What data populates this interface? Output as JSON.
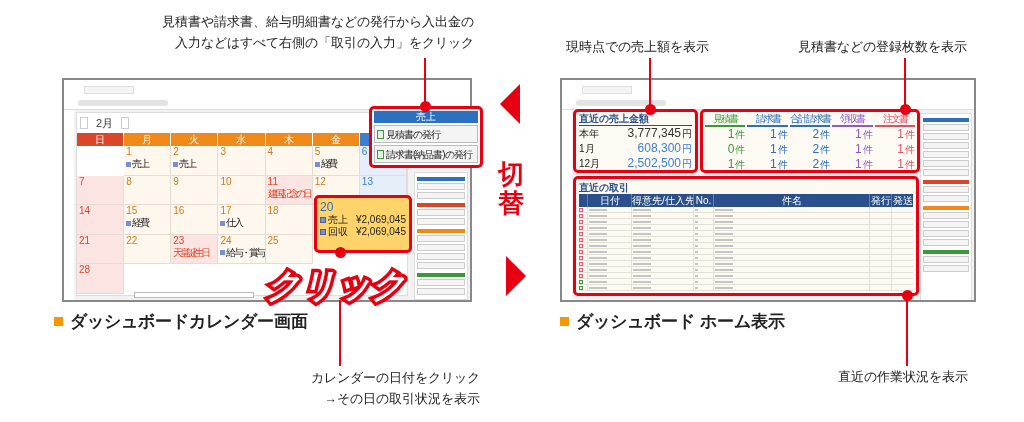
{
  "left_note": [
    "見積書や請求書、給与明細書などの発行から入出金の",
    "入力などはすべて右側の「取引の入力」をクリック"
  ],
  "price_note": "現時点での売上額を表示",
  "count_note": "見積書などの登録枚数を表示",
  "switch_label": "切替",
  "calendar_screen": {
    "month": "2月",
    "weekdays": [
      {
        "label": "日",
        "kind": "sun"
      },
      {
        "label": "月",
        "kind": "weekday"
      },
      {
        "label": "火",
        "kind": "weekday"
      },
      {
        "label": "水",
        "kind": "weekday"
      },
      {
        "label": "木",
        "kind": "weekday"
      },
      {
        "label": "金",
        "kind": "weekday"
      }
    ],
    "weeks": [
      [
        {
          "day": "1",
          "entries": [
            "売上"
          ]
        },
        {
          "day": "2",
          "entries": [
            "売上"
          ]
        },
        {
          "day": "3"
        },
        {
          "day": "4"
        },
        {
          "day": "5",
          "entries": [
            "経費"
          ]
        },
        {
          "day": "6"
        }
      ],
      [
        {
          "day": "7"
        },
        {
          "day": "8"
        },
        {
          "day": "9"
        },
        {
          "day": "10"
        },
        {
          "day": "11",
          "holiday": "建国記念の日"
        },
        {
          "day": "12"
        },
        {
          "day": "13"
        }
      ],
      [
        {
          "day": "14"
        },
        {
          "day": "15",
          "entries": [
            "経費"
          ]
        },
        {
          "day": "16"
        },
        {
          "day": "17",
          "entries": [
            "仕入"
          ]
        },
        {
          "day": "18"
        }
      ],
      [
        {
          "day": "21"
        },
        {
          "day": "22"
        },
        {
          "day": "23",
          "holiday": "天皇誕生日"
        },
        {
          "day": "24",
          "entries": [
            "給与・賞与"
          ]
        },
        {
          "day": "25"
        }
      ],
      [
        {
          "day": "28"
        }
      ]
    ],
    "popup": {
      "title": "売上",
      "buttons": [
        "見積書の発行",
        "請求書(納品書)の発行"
      ]
    },
    "day_card": {
      "day": "20",
      "rows": [
        {
          "label": "売上",
          "amount": "¥2,069,045"
        },
        {
          "label": "回収",
          "amount": "¥2,069,045"
        }
      ]
    },
    "click_label": "クリック"
  },
  "home_screen": {
    "sales": {
      "title": "直近の売上金額",
      "rows": [
        {
          "label": "本年",
          "value": "3,777,345",
          "unit": "円",
          "color": "#333333"
        },
        {
          "label": "1月",
          "value": "608,300",
          "unit": "円",
          "color": "#3b7fd4"
        },
        {
          "label": "12月",
          "value": "2,502,500",
          "unit": "円",
          "color": "#3b7fd4"
        }
      ]
    },
    "counts": [
      {
        "label": "見積書",
        "color": "#3a9a3a",
        "cells": [
          {
            "value": "1",
            "unit": "件"
          },
          {
            "value": "0",
            "unit": "件"
          },
          {
            "value": "1",
            "unit": "件"
          }
        ]
      },
      {
        "label": "請求書",
        "color": "#2a6fc0",
        "cells": [
          {
            "value": "1",
            "unit": "件"
          },
          {
            "value": "1",
            "unit": "件"
          },
          {
            "value": "1",
            "unit": "件"
          }
        ]
      },
      {
        "label": "合計請求書",
        "color": "#2a6fc0",
        "cells": [
          {
            "value": "2",
            "unit": "件"
          },
          {
            "value": "2",
            "unit": "件"
          },
          {
            "value": "2",
            "unit": "件"
          }
        ]
      },
      {
        "label": "領収書",
        "color": "#8a5cc8",
        "cells": [
          {
            "value": "1",
            "unit": "件"
          },
          {
            "value": "1",
            "unit": "件"
          },
          {
            "value": "1",
            "unit": "件"
          }
        ]
      },
      {
        "label": "注文書",
        "color": "#e0506a",
        "cells": [
          {
            "value": "1",
            "unit": "件"
          },
          {
            "value": "1",
            "unit": "件"
          },
          {
            "value": "1",
            "unit": "件"
          }
        ]
      }
    ],
    "recent": {
      "title": "直近の取引",
      "columns": [
        "日付",
        "得意先/仕入先",
        "No.",
        "件名",
        "発行",
        "発送"
      ]
    }
  },
  "calendar_caption": "ダッシュボードカレンダー画面",
  "home_caption": "ダッシュボード ホーム表示",
  "calendar_note": [
    "カレンダーの日付をクリック",
    "→その日の取引状況を表示"
  ],
  "recent_note": "直近の作業状況を表示"
}
